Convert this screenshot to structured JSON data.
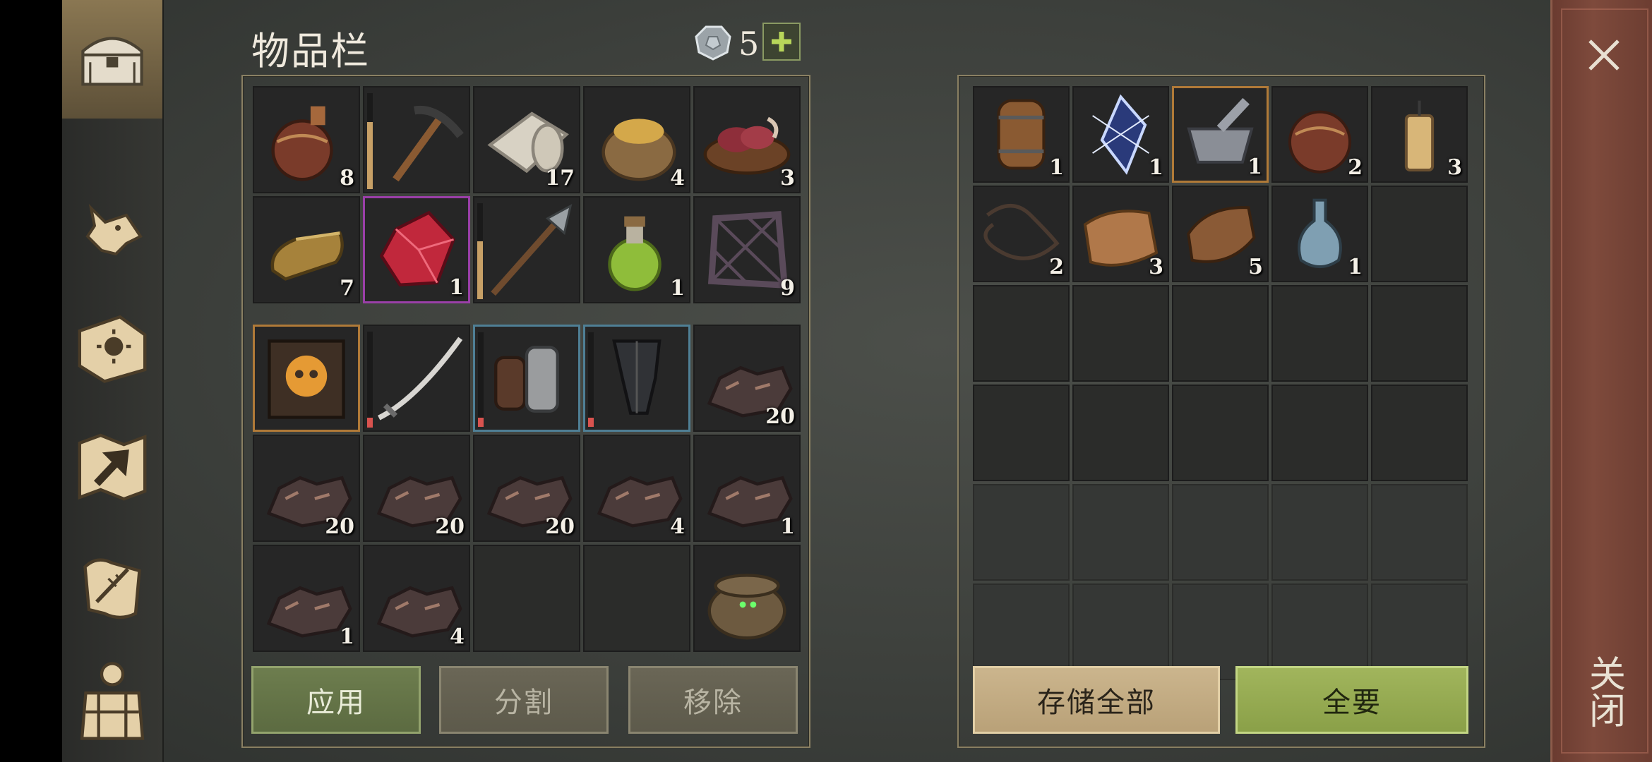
{
  "header": {
    "title": "物品栏",
    "gem_count": "5",
    "gem_icon": "stone-gem-icon",
    "add_icon": "plus-icon"
  },
  "sidebar": {
    "items": [
      {
        "name": "chest",
        "icon": "chest-icon",
        "active": true
      },
      {
        "name": "wolf",
        "icon": "wolf-head-icon"
      },
      {
        "name": "book",
        "icon": "sun-book-icon"
      },
      {
        "name": "map",
        "icon": "map-arrow-icon"
      },
      {
        "name": "scroll",
        "icon": "quill-scroll-icon"
      },
      {
        "name": "character",
        "icon": "character-armor-icon"
      }
    ]
  },
  "close": {
    "icon": "close-icon",
    "label": "关闭"
  },
  "inventory": {
    "pockets": [
      {
        "item": "flask",
        "qty": "8"
      },
      {
        "item": "pickaxe",
        "qty": "",
        "durability": 0.7
      },
      {
        "item": "cloth-roll",
        "qty": "17"
      },
      {
        "item": "grain-sack",
        "qty": "4"
      },
      {
        "item": "raw-meat-bowl",
        "qty": "3"
      },
      {
        "item": "gold-ingot",
        "qty": "7"
      },
      {
        "item": "red-crystal",
        "qty": "1",
        "highlight": "purple"
      },
      {
        "item": "halberd",
        "qty": "",
        "durability": 0.6
      },
      {
        "item": "green-potion",
        "qty": "1"
      },
      {
        "item": "wooden-frame",
        "qty": "9"
      }
    ],
    "backpack": [
      {
        "item": "skull-book",
        "qty": "",
        "highlight": "orange"
      },
      {
        "item": "sword",
        "qty": "",
        "durability": 0.1
      },
      {
        "item": "gauntlets",
        "qty": "",
        "durability": 0.1,
        "highlight": "blue"
      },
      {
        "item": "greaves",
        "qty": "",
        "durability": 0.1,
        "highlight": "blue"
      },
      {
        "item": "iron-ore",
        "qty": "20"
      },
      {
        "item": "iron-ore",
        "qty": "20"
      },
      {
        "item": "iron-ore",
        "qty": "20"
      },
      {
        "item": "iron-ore",
        "qty": "20"
      },
      {
        "item": "iron-ore",
        "qty": "4"
      },
      {
        "item": "iron-ore",
        "qty": "1"
      },
      {
        "item": "iron-ore",
        "qty": "1"
      },
      {
        "item": "iron-ore",
        "qty": "4"
      },
      {
        "item": "",
        "qty": ""
      },
      {
        "item": "",
        "qty": ""
      },
      {
        "item": "wicker-basket",
        "qty": ""
      }
    ],
    "buttons": {
      "apply": "应用",
      "split": "分割",
      "remove": "移除"
    }
  },
  "storage": {
    "items": [
      {
        "item": "barrel",
        "qty": "1"
      },
      {
        "item": "blue-crystal",
        "qty": "1"
      },
      {
        "item": "mortar",
        "qty": "1",
        "highlight": "orange"
      },
      {
        "item": "waterskin",
        "qty": "2"
      },
      {
        "item": "candle",
        "qty": "3"
      },
      {
        "item": "rope",
        "qty": "2"
      },
      {
        "item": "cloth",
        "qty": "3"
      },
      {
        "item": "leather",
        "qty": "5"
      },
      {
        "item": "bottle",
        "qty": "1"
      },
      {
        "item": "",
        "qty": ""
      }
    ],
    "empty_rows": 2,
    "faint_rows": 2,
    "buttons": {
      "store_all": "存储全部",
      "take_all": "全要"
    }
  }
}
